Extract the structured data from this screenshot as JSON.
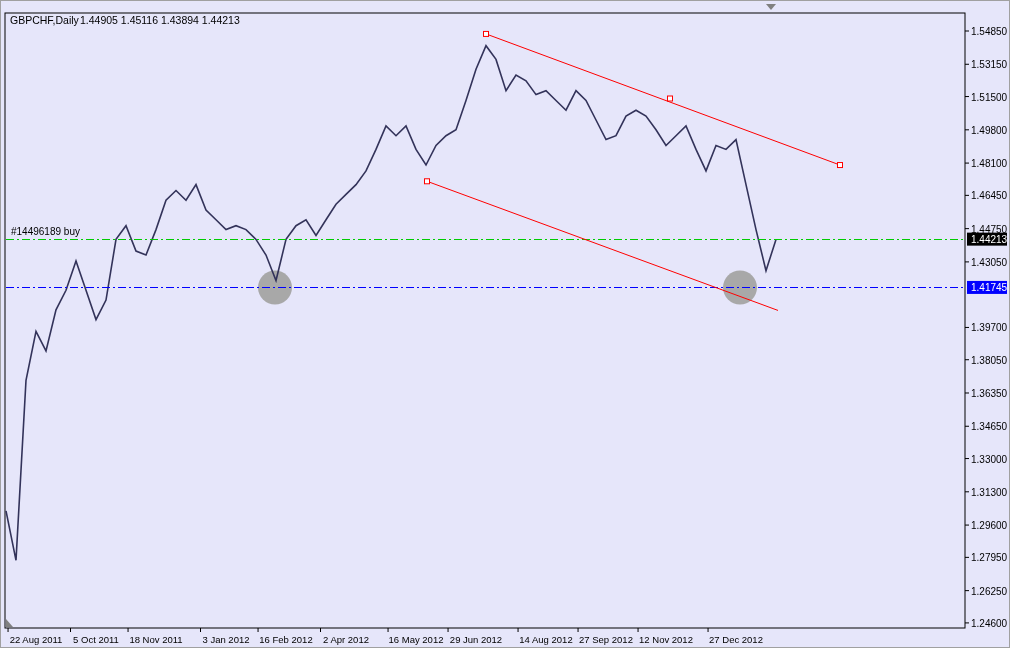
{
  "header": {
    "symbol": "GBPCHF,Daily",
    "quote": "1.44905 1.45116 1.43894 1.44213"
  },
  "price_lines": [
    {
      "kind": "order",
      "color": "#00cc00",
      "label": "1.44213",
      "text": "#14496189 buy"
    },
    {
      "kind": "level",
      "color": "#0000ff",
      "label": "1.41745"
    }
  ],
  "chart_data": {
    "type": "line",
    "categories": [
      null,
      null,
      null,
      "22 Aug 2011",
      null,
      null,
      null,
      null,
      null,
      "5 Oct 2011",
      null,
      null,
      null,
      null,
      null,
      "18 Nov 2011",
      null,
      null,
      null,
      null,
      null,
      null,
      "3 Jan 2012",
      null,
      null,
      null,
      null,
      null,
      "16 Feb 2012",
      null,
      null,
      null,
      null,
      null,
      "2 Apr 2012",
      null,
      null,
      null,
      null,
      null,
      null,
      "16 May 2012",
      null,
      null,
      null,
      null,
      null,
      "29 Jun 2012",
      null,
      null,
      null,
      null,
      null,
      null,
      "14 Aug 2012",
      null,
      null,
      null,
      null,
      null,
      "27 Sep 2012",
      null,
      null,
      null,
      null,
      null,
      "12 Nov 2012",
      null,
      null,
      null,
      null,
      null,
      null,
      "27 Dec 2012",
      null,
      null,
      null,
      null,
      null,
      null,
      null,
      null,
      null,
      null,
      null,
      null,
      null,
      null,
      null,
      null,
      null,
      null,
      null,
      null,
      null,
      null
    ],
    "series": [
      {
        "color": "#33335a",
        "values": [
          1.3033,
          1.278,
          1.37,
          1.395,
          1.385,
          1.406,
          1.416,
          1.431,
          1.416,
          1.401,
          1.411,
          1.442,
          1.449,
          1.436,
          1.434,
          1.447,
          1.462,
          1.467,
          1.462,
          1.47,
          1.457,
          1.452,
          1.447,
          1.449,
          1.447,
          1.442,
          1.434,
          1.421,
          1.442,
          1.449,
          1.452,
          1.444,
          1.452,
          1.46,
          1.465,
          1.47,
          1.477,
          1.488,
          1.5,
          1.495,
          1.5,
          1.488,
          1.48,
          1.49,
          1.495,
          1.498,
          1.513,
          1.529,
          1.541,
          1.534,
          1.518,
          1.526,
          1.523,
          1.516,
          1.518,
          1.513,
          1.508,
          1.518,
          1.513,
          1.503,
          1.493,
          1.495,
          1.505,
          1.508,
          1.505,
          1.498,
          1.49,
          1.495,
          1.5,
          1.488,
          1.477,
          1.49,
          1.488,
          1.493,
          1.47,
          1.447,
          1.426,
          1.442,
          null,
          null,
          null,
          null,
          null,
          null,
          null,
          null,
          null,
          null,
          null,
          null,
          null,
          null,
          null,
          null,
          null,
          null
        ]
      }
    ],
    "ylim": [
      1.2434,
      1.5577
    ],
    "yticks": [
      {
        "value": 1.5485,
        "label": "1.54850"
      },
      {
        "value": 1.5315,
        "label": "1.53150"
      },
      {
        "value": 1.515,
        "label": "1.51500"
      },
      {
        "value": 1.498,
        "label": "1.49800"
      },
      {
        "value": 1.481,
        "label": "1.48100"
      },
      {
        "value": 1.4645,
        "label": "1.46450"
      },
      {
        "value": 1.4475,
        "label": "1.44750"
      },
      {
        "value": 1.4305,
        "label": "1.43050"
      },
      {
        "value": 1.397,
        "label": "1.39700"
      },
      {
        "value": 1.3805,
        "label": "1.38050"
      },
      {
        "value": 1.3635,
        "label": "1.36350"
      },
      {
        "value": 1.3465,
        "label": "1.34650"
      },
      {
        "value": 1.33,
        "label": "1.33000"
      },
      {
        "value": 1.313,
        "label": "1.31300"
      },
      {
        "value": 1.296,
        "label": "1.29600"
      },
      {
        "value": 1.2795,
        "label": "1.27950"
      },
      {
        "value": 1.2625,
        "label": "1.26250"
      },
      {
        "value": 1.246,
        "label": "1.24600"
      }
    ]
  }
}
